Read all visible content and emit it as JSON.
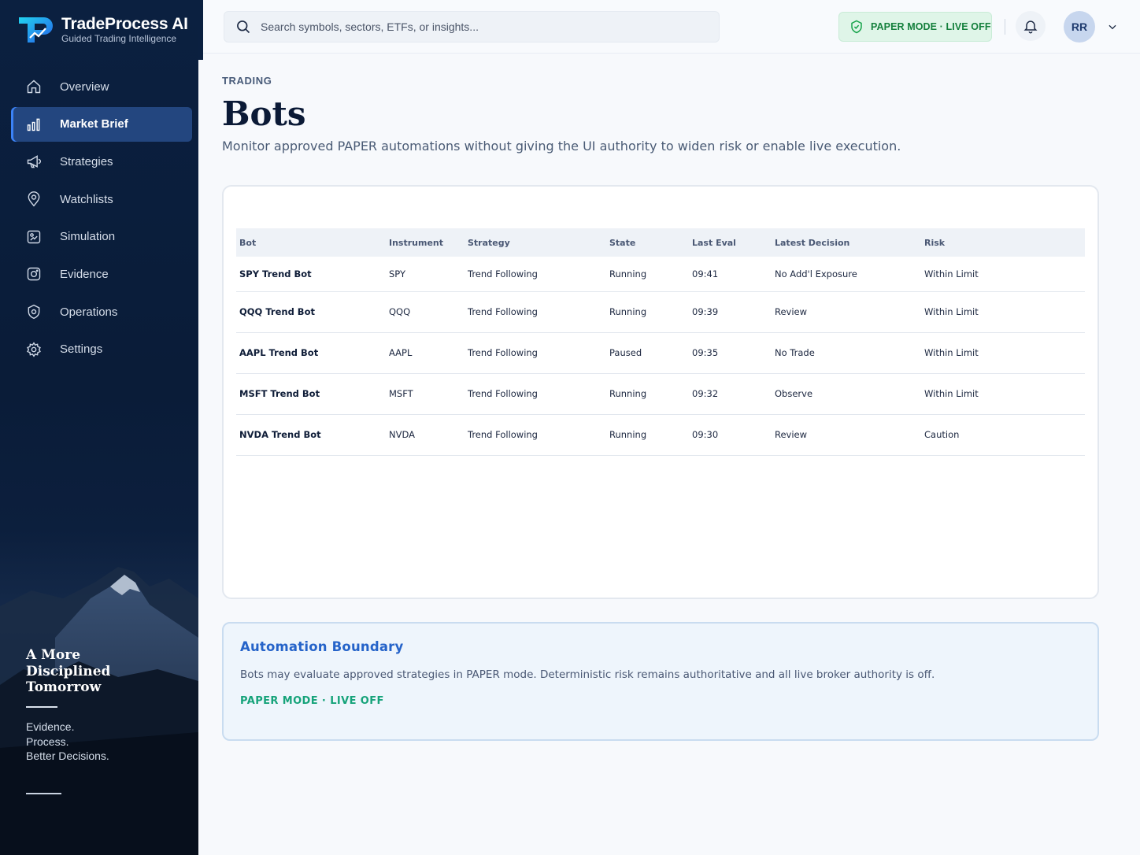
{
  "brand": {
    "title": "TradeProcess AI",
    "subtitle": "Guided Trading Intelligence"
  },
  "sidebar": {
    "items": [
      {
        "label": "Overview",
        "icon": "home-icon",
        "active": false
      },
      {
        "label": "Market Brief",
        "icon": "bar-chart-icon",
        "active": true
      },
      {
        "label": "Strategies",
        "icon": "megaphone-icon",
        "active": false
      },
      {
        "label": "Watchlists",
        "icon": "location-pin-icon",
        "active": false
      },
      {
        "label": "Simulation",
        "icon": "simulation-icon",
        "active": false
      },
      {
        "label": "Evidence",
        "icon": "camera-icon",
        "active": false
      },
      {
        "label": "Operations",
        "icon": "shield-icon",
        "active": false
      },
      {
        "label": "Settings",
        "icon": "gear-icon",
        "active": false
      }
    ],
    "tagline": "A More Disciplined Tomorrow",
    "tagline_sub": [
      "Evidence.",
      "Process.",
      "Better Decisions."
    ]
  },
  "topbar": {
    "search_placeholder": "Search symbols, sectors, ETFs, or insights...",
    "mode_label": "PAPER MODE · LIVE OFF",
    "avatar_initials": "RR"
  },
  "page": {
    "eyebrow": "TRADING",
    "title": "Bots",
    "subtitle": "Monitor approved PAPER automations without giving the UI authority to widen risk or enable live execution."
  },
  "table": {
    "columns": [
      "Bot",
      "Instrument",
      "Strategy",
      "State",
      "Last Eval",
      "Latest Decision",
      "Risk"
    ],
    "rows": [
      [
        "SPY Trend Bot",
        "SPY",
        "Trend Following",
        "Running",
        "09:41",
        "No Add'l Exposure",
        "Within Limit"
      ],
      [
        "QQQ Trend Bot",
        "QQQ",
        "Trend Following",
        "Running",
        "09:39",
        "Review",
        "Within Limit"
      ],
      [
        "AAPL Trend Bot",
        "AAPL",
        "Trend Following",
        "Paused",
        "09:35",
        "No Trade",
        "Within Limit"
      ],
      [
        "MSFT Trend Bot",
        "MSFT",
        "Trend Following",
        "Running",
        "09:32",
        "Observe",
        "Within Limit"
      ],
      [
        "NVDA Trend Bot",
        "NVDA",
        "Trend Following",
        "Running",
        "09:30",
        "Review",
        "Caution"
      ]
    ]
  },
  "boundary": {
    "title": "Automation Boundary",
    "text": "Bots may evaluate approved strategies in PAPER mode. Deterministic risk remains authoritative and all live broker authority is off.",
    "mode": "PAPER MODE · LIVE OFF"
  },
  "colors": {
    "accent": "#2563c9",
    "sidebar": "#0b2040",
    "success": "#16a34a"
  }
}
